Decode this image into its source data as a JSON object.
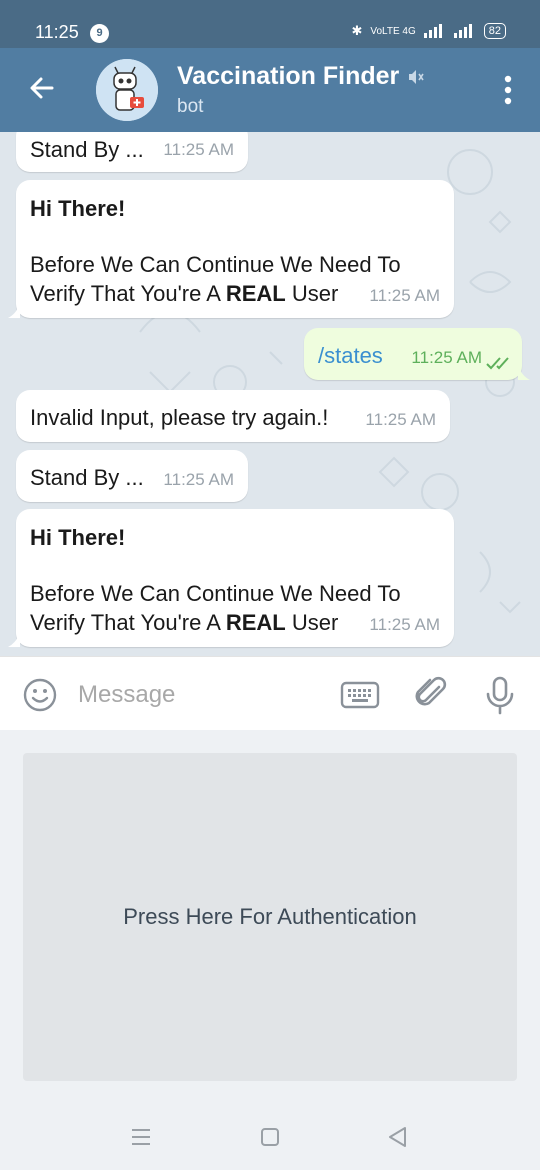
{
  "status_bar": {
    "time": "11:25",
    "notification_count": "9",
    "network_text": "VoLTE 4G",
    "battery": "82"
  },
  "header": {
    "title": "Vaccination Finder",
    "subtitle": "bot"
  },
  "messages": [
    {
      "direction": "in",
      "text": "Stand By ...",
      "time": "11:25 AM"
    },
    {
      "direction": "in",
      "line1": "Hi There!",
      "line2": "Before We Can Continue We Need To",
      "line3_prefix": "Verify That You're A ",
      "line3_bold": "REAL",
      "line3_suffix": " User",
      "time": "11:25 AM"
    },
    {
      "direction": "out",
      "text": "/states",
      "time": "11:25 AM",
      "status": "read"
    },
    {
      "direction": "in",
      "text": "Invalid Input, please try again.!",
      "time": "11:25 AM"
    },
    {
      "direction": "in",
      "text": "Stand By ...",
      "time": "11:25 AM"
    },
    {
      "direction": "in",
      "line1": "Hi There!",
      "line2": "Before We Can Continue We Need To",
      "line3_prefix": "Verify That You're A ",
      "line3_bold": "REAL",
      "line3_suffix": " User",
      "time": "11:25 AM"
    }
  ],
  "composer": {
    "placeholder": "Message"
  },
  "bot_keyboard": {
    "button_label": "Press Here For Authentication"
  },
  "colors": {
    "header": "#517da2",
    "status_bar": "#4a6b86",
    "chat_bg": "#dfe6ec",
    "out_bubble": "#effdde",
    "link_blue": "#3a8fd0",
    "read_check": "#5eb05b"
  },
  "icons": [
    "back-arrow",
    "mute",
    "more-vertical",
    "emoji",
    "keyboard",
    "attach",
    "microphone",
    "menu-lines",
    "home-square",
    "back-triangle"
  ]
}
